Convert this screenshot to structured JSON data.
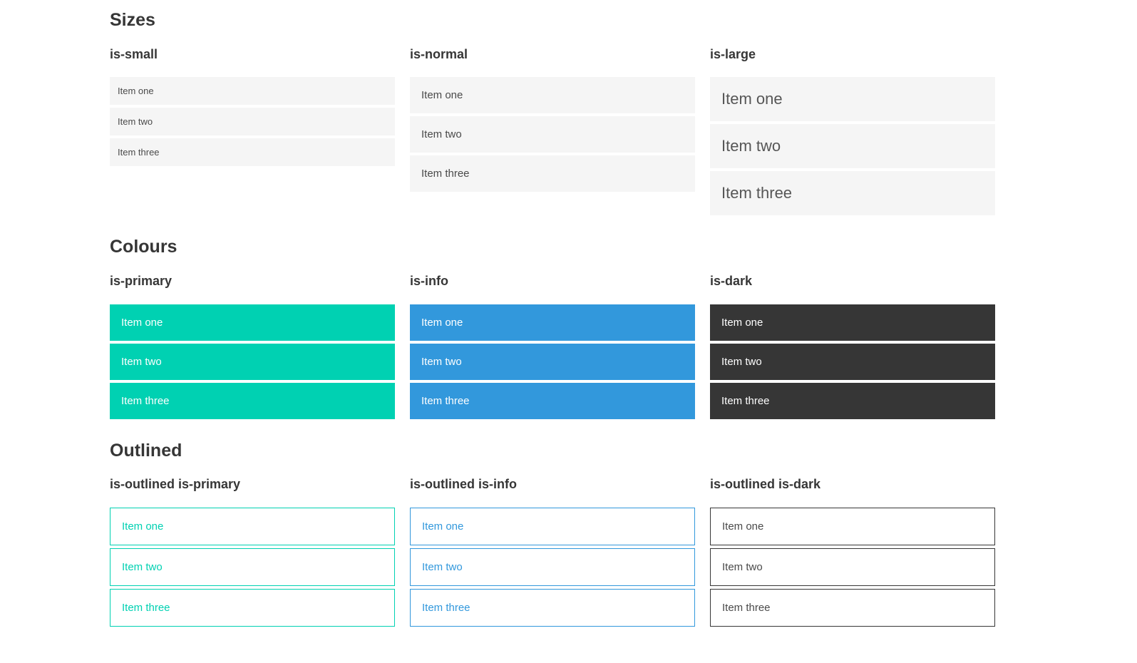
{
  "colors": {
    "primary": "#00d1b2",
    "info": "#3298dc",
    "dark": "#363636",
    "item_background_gray": "#f5f5f5",
    "item_text_gray": "#4a4a4a",
    "heading_text": "#363636",
    "page_background": "#ffffff"
  },
  "sections": [
    {
      "title": "Sizes",
      "groups": [
        {
          "label": "is-small",
          "items": [
            "Item one",
            "Item two",
            "Item three"
          ]
        },
        {
          "label": "is-normal",
          "items": [
            "Item one",
            "Item two",
            "Item three"
          ]
        },
        {
          "label": "is-large",
          "items": [
            "Item one",
            "Item two",
            "Item three"
          ]
        }
      ]
    },
    {
      "title": "Colours",
      "groups": [
        {
          "label": "is-primary",
          "items": [
            "Item one",
            "Item two",
            "Item three"
          ]
        },
        {
          "label": "is-info",
          "items": [
            "Item one",
            "Item two",
            "Item three"
          ]
        },
        {
          "label": "is-dark",
          "items": [
            "Item one",
            "Item two",
            "Item three"
          ]
        }
      ]
    },
    {
      "title": "Outlined",
      "groups": [
        {
          "label": "is-outlined is-primary",
          "items": [
            "Item one",
            "Item two",
            "Item three"
          ]
        },
        {
          "label": "is-outlined is-info",
          "items": [
            "Item one",
            "Item two",
            "Item three"
          ]
        },
        {
          "label": "is-outlined is-dark",
          "items": [
            "Item one",
            "Item two",
            "Item three"
          ]
        }
      ]
    }
  ]
}
